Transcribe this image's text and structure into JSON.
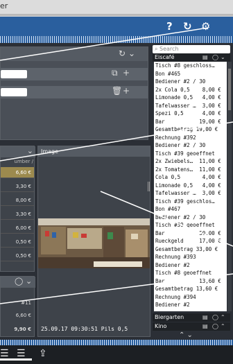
{
  "titlebar": {
    "text": "er"
  },
  "header": {
    "help_icon": "?",
    "refresh_icon": "↻",
    "settings_icon": "⚙"
  },
  "left": {
    "col_header": "umber / Value",
    "prices": [
      "6,60 €",
      "3,30 €",
      "8,00 €",
      "3,30 €",
      "6,00 €",
      "0,50 €",
      "0,50 €"
    ],
    "bottom_id": "#11",
    "bottom_amount": "6,60 €",
    "bottom_total": "9,90 €"
  },
  "image": {
    "heading": "Image",
    "caption": "25.09.17 09:30:51 Pils 0,5"
  },
  "sidebar": {
    "search_placeholder": "Search",
    "section_eiscafe": "Eiscafé",
    "section_biergarten": "Biergarten",
    "section_kino": "Kino",
    "ticket_lines": [
      "Tisch #8 geschloss…",
      "Bon #465",
      "Bediener #2 / 30",
      "2x Cola 0,5    8,00 €",
      "Limonade 0,5   4,00 €",
      "Tafelwasser …  3,00 €",
      "Spezi 0,5      4,00 €",
      "Bar           19,00 €",
      "Gesamtbetrag 19,00 €",
      "Rechnung #392",
      "Bediener #2 / 30",
      "Tisch #39 geoeffnet",
      "2x Zwiebels…  11,00 €",
      "2x Tomatens…  11,00 €",
      "Cola 0,5       4,00 €",
      "Limonade 0,5   4,00 €",
      "Tafelwasser …  3,00 €",
      "Tisch #39 geschlos…",
      "Bon #467",
      "Bediener #2 / 30",
      "Tisch #39 geoeffnet",
      "Bar           50,00 €",
      "Rueckgeld     17,00 €",
      "Gesamtbetrag 33,00 €",
      "Rechnung #393",
      "Bediener #2",
      "Tisch #8 geoeffnet",
      "Bar           13,60 €",
      "Gesamtbetrag 13,60 €",
      "Rechnung #394",
      "Bediener #2"
    ]
  }
}
